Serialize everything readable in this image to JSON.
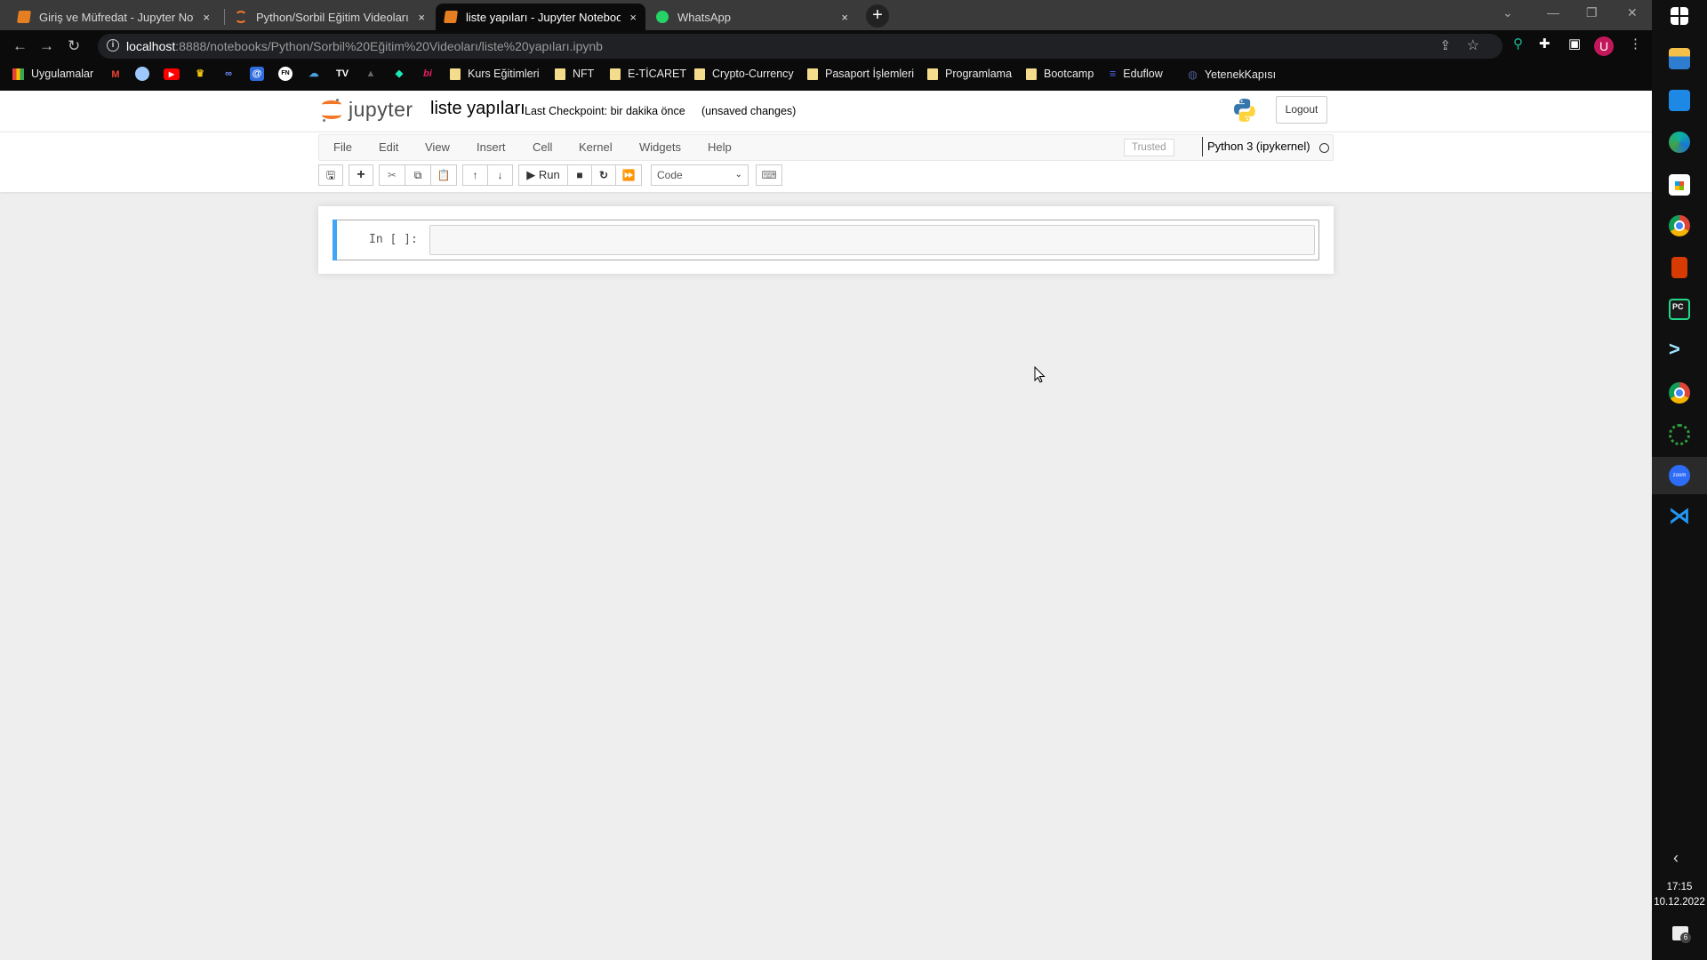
{
  "browser": {
    "tabs": [
      {
        "label": "Giriş ve Müfredat - Jupyter Notebook",
        "icon": "jupyter-notebook-icon",
        "active": false
      },
      {
        "label": "Python/Sorbil Eğitim Videoları/",
        "icon": "jupyter-loading-icon",
        "active": false
      },
      {
        "label": "liste yapıları - Jupyter Notebook",
        "icon": "jupyter-notebook-icon",
        "active": true
      },
      {
        "label": "WhatsApp",
        "icon": "whatsapp-icon",
        "active": false
      }
    ],
    "close_glyph": "×",
    "new_tab_glyph": "+",
    "address": {
      "host": "localhost",
      "path": ":8888/notebooks/Python/Sorbil%20Eğitim%20Videoları/liste%20yapıları.ipynb"
    },
    "profile_initial": "U",
    "bookmarks": {
      "apps_label": "Uygulamalar",
      "folders": [
        "Kurs Eğitimleri",
        "NFT",
        "E-TİCARET",
        "Crypto-Currency",
        "Pasaport İşlemleri",
        "Programlama",
        "Bootcamp"
      ],
      "links": [
        "Eduflow",
        "YetenekKapısı"
      ]
    }
  },
  "jupyter": {
    "logo_text": "jupyter",
    "notebook_title": "liste yapıları",
    "checkpoint": "Last Checkpoint: bir dakika önce",
    "unsaved": "(unsaved changes)",
    "logout_label": "Logout",
    "menu": [
      "File",
      "Edit",
      "View",
      "Insert",
      "Cell",
      "Kernel",
      "Widgets",
      "Help"
    ],
    "trusted_label": "Trusted",
    "kernel_name": "Python 3 (ipykernel)",
    "toolbar": {
      "run_label": "Run",
      "cell_type": "Code"
    },
    "cells": [
      {
        "prompt": "In [ ]:",
        "source": ""
      }
    ]
  },
  "taskbar": {
    "time": "17:15",
    "date": "10.12.2022",
    "notification_count": "6"
  }
}
